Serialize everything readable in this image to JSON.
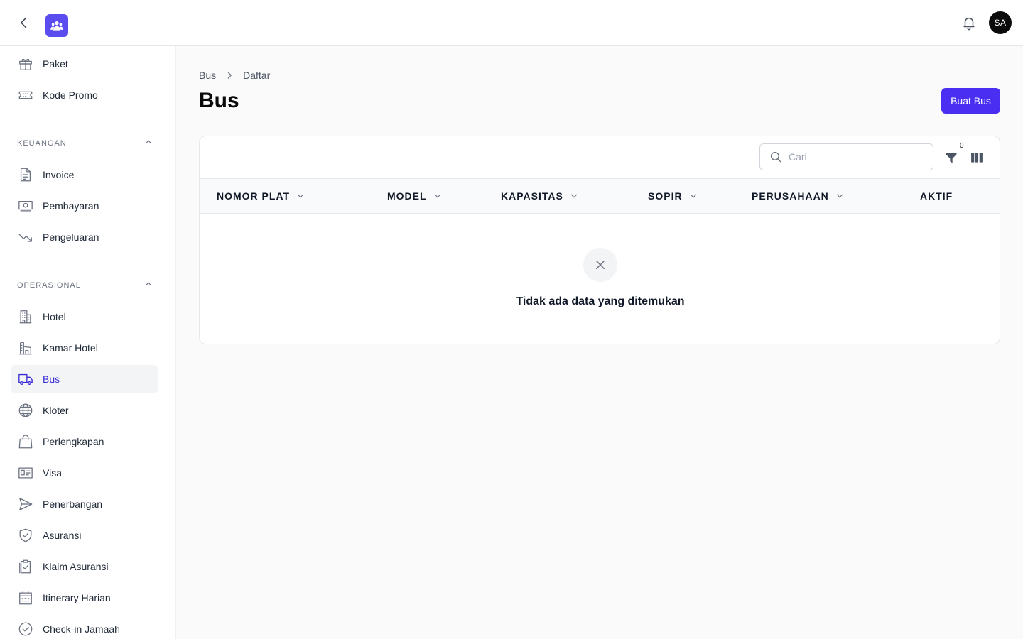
{
  "header": {
    "avatar_initials": "SA"
  },
  "sidebar": {
    "items_top": [
      {
        "label": "Paket",
        "icon": "gift-icon"
      },
      {
        "label": "Kode Promo",
        "icon": "ticket-icon"
      }
    ],
    "sections": [
      {
        "title": "KEUANGAN",
        "items": [
          {
            "label": "Invoice",
            "icon": "document-icon"
          },
          {
            "label": "Pembayaran",
            "icon": "banknote-icon"
          },
          {
            "label": "Pengeluaran",
            "icon": "trending-down-icon"
          }
        ]
      },
      {
        "title": "OPERASIONAL",
        "items": [
          {
            "label": "Hotel",
            "icon": "building-icon"
          },
          {
            "label": "Kamar Hotel",
            "icon": "building-room-icon"
          },
          {
            "label": "Bus",
            "icon": "truck-icon",
            "active": true
          },
          {
            "label": "Kloter",
            "icon": "globe-icon"
          },
          {
            "label": "Perlengkapan",
            "icon": "shopping-bag-icon"
          },
          {
            "label": "Visa",
            "icon": "id-card-icon"
          },
          {
            "label": "Penerbangan",
            "icon": "paper-plane-icon"
          },
          {
            "label": "Asuransi",
            "icon": "shield-check-icon"
          },
          {
            "label": "Klaim Asuransi",
            "icon": "clipboard-check-icon"
          },
          {
            "label": "Itinerary Harian",
            "icon": "calendar-icon"
          },
          {
            "label": "Check-in Jamaah",
            "icon": "check-circle-icon"
          }
        ]
      }
    ]
  },
  "breadcrumb": [
    "Bus",
    "Daftar"
  ],
  "page": {
    "title": "Bus",
    "create_button": "Buat Bus"
  },
  "table": {
    "search_placeholder": "Cari",
    "filter_count": "0",
    "columns": [
      "NOMOR PLAT",
      "MODEL",
      "KAPASITAS",
      "SOPIR",
      "PERUSAHAAN",
      "AKTIF"
    ],
    "empty_text": "Tidak ada data yang ditemukan"
  },
  "colors": {
    "accent": "#4a2ff2",
    "active_text": "#3d2fd6",
    "logo_bg": "#5b4cf0"
  }
}
